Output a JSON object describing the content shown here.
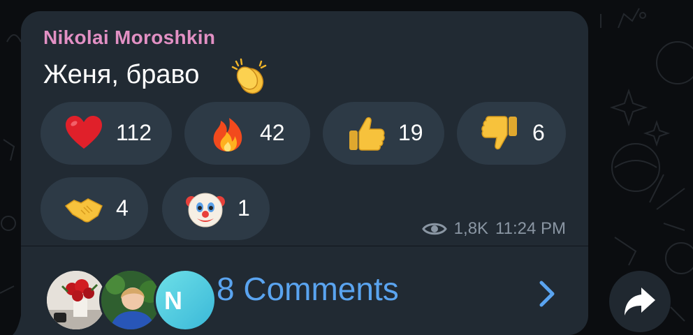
{
  "message": {
    "sender": "Nikolai Moroshkin",
    "text": "Женя, браво",
    "text_emoji": "clapping-hands"
  },
  "reactions": [
    {
      "icon": "heart-icon",
      "count": "112"
    },
    {
      "icon": "fire-icon",
      "count": "42"
    },
    {
      "icon": "thumbs-up-icon",
      "count": "19"
    },
    {
      "icon": "thumbs-down-icon",
      "count": "6"
    },
    {
      "icon": "handshake-icon",
      "count": "4"
    },
    {
      "icon": "clown-face-icon",
      "count": "1"
    }
  ],
  "meta": {
    "views": "1,8K",
    "time": "11:24 PM"
  },
  "comments": {
    "label": "8 Comments",
    "avatar_letter": "N"
  },
  "colors": {
    "bubble": "#212a33",
    "sender": "#e290c4",
    "link": "#5aa4f0",
    "reaction_pill": "#2d3a46"
  }
}
